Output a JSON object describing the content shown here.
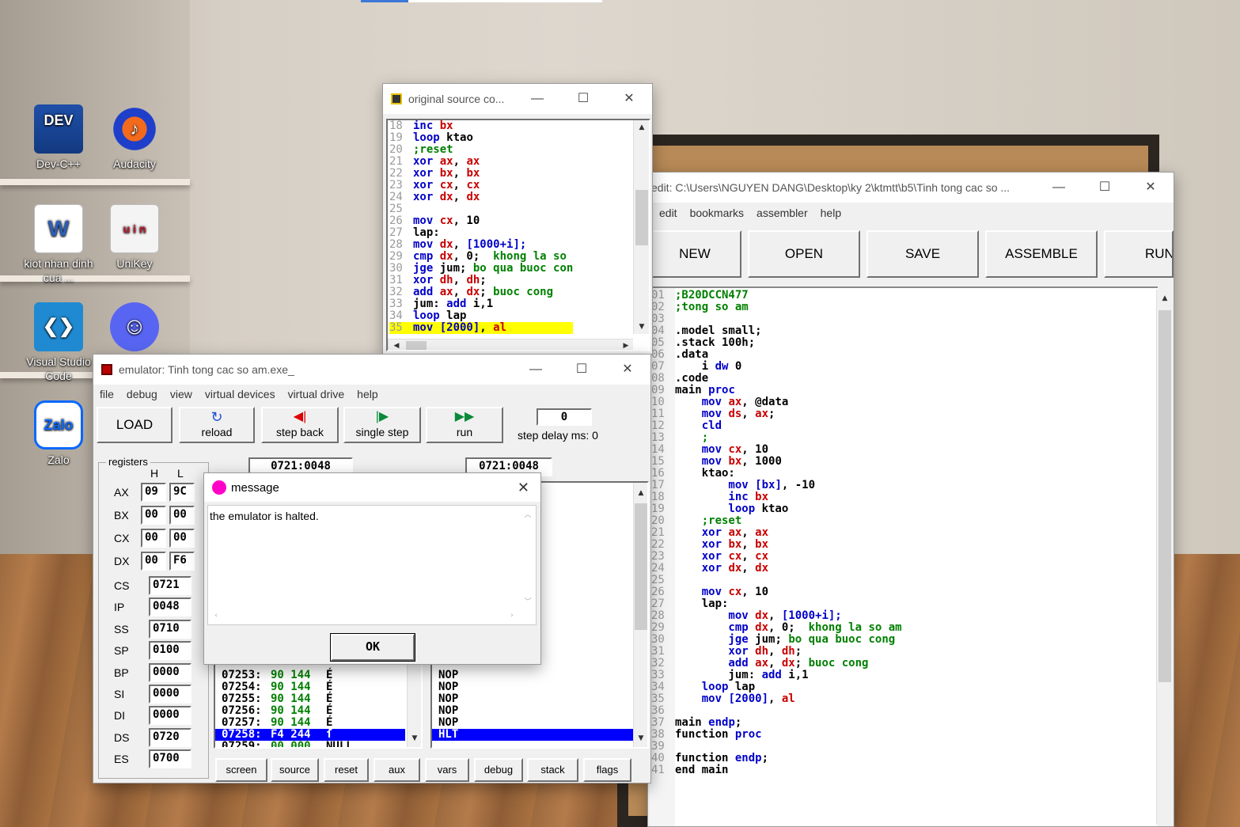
{
  "desktop": {
    "icons": [
      {
        "label": "Dev-C++",
        "name": "devcpp-icon",
        "glyph": "DEV"
      },
      {
        "label": "Audacity",
        "name": "audacity-icon",
        "glyph": "♪"
      },
      {
        "label": "kiot nhan dinh cua ...",
        "name": "word-doc-icon",
        "glyph": "W"
      },
      {
        "label": "UniKey",
        "name": "unikey-icon",
        "glyph": "u i n"
      },
      {
        "label": "Visual Studio Code",
        "name": "vscode-icon",
        "glyph": "❮❯"
      },
      {
        "label": "",
        "name": "discord-icon",
        "glyph": "☺"
      },
      {
        "label": "Zalo",
        "name": "zalo-icon",
        "glyph": "Zalo"
      }
    ]
  },
  "source_window": {
    "title": "original source co...",
    "lines": [
      {
        "n": "18",
        "code": [
          [
            "inc ",
            "k"
          ],
          [
            "bx",
            "r"
          ]
        ]
      },
      {
        "n": "19",
        "code": [
          [
            "loop ",
            "k"
          ],
          [
            "ktao",
            "bk"
          ]
        ]
      },
      {
        "n": "20",
        "code": [
          [
            ";reset",
            "g"
          ]
        ]
      },
      {
        "n": "21",
        "code": [
          [
            "xor ",
            "k"
          ],
          [
            "ax",
            "r"
          ],
          [
            ", ",
            "bk"
          ],
          [
            "ax",
            "r"
          ]
        ]
      },
      {
        "n": "22",
        "code": [
          [
            "xor ",
            "k"
          ],
          [
            "bx",
            "r"
          ],
          [
            ", ",
            "bk"
          ],
          [
            "bx",
            "r"
          ]
        ]
      },
      {
        "n": "23",
        "code": [
          [
            "xor ",
            "k"
          ],
          [
            "cx",
            "r"
          ],
          [
            ", ",
            "bk"
          ],
          [
            "cx",
            "r"
          ]
        ]
      },
      {
        "n": "24",
        "code": [
          [
            "xor ",
            "k"
          ],
          [
            "dx",
            "r"
          ],
          [
            ", ",
            "bk"
          ],
          [
            "dx",
            "r"
          ]
        ]
      },
      {
        "n": "25",
        "code": []
      },
      {
        "n": "26",
        "code": [
          [
            "mov ",
            "k"
          ],
          [
            "cx",
            "r"
          ],
          [
            ", 10",
            "bk"
          ]
        ]
      },
      {
        "n": "27",
        "code": [
          [
            "lap:",
            "bk"
          ]
        ]
      },
      {
        "n": "28",
        "code": [
          [
            "mov ",
            "k"
          ],
          [
            "dx",
            "r"
          ],
          [
            ", ",
            "bk"
          ],
          [
            "[1000+i];",
            "k"
          ]
        ]
      },
      {
        "n": "29",
        "code": [
          [
            "cmp ",
            "k"
          ],
          [
            "dx",
            "r"
          ],
          [
            ", 0;  ",
            "bk"
          ],
          [
            "khong la so",
            "g"
          ]
        ]
      },
      {
        "n": "30",
        "code": [
          [
            "jge ",
            "k"
          ],
          [
            "jum; ",
            "bk"
          ],
          [
            "bo qua buoc con",
            "g"
          ]
        ]
      },
      {
        "n": "31",
        "code": [
          [
            "xor ",
            "k"
          ],
          [
            "dh",
            "r"
          ],
          [
            ", ",
            "bk"
          ],
          [
            "dh",
            "r"
          ],
          [
            ";",
            "bk"
          ]
        ]
      },
      {
        "n": "32",
        "code": [
          [
            "add ",
            "k"
          ],
          [
            "ax",
            "r"
          ],
          [
            ", ",
            "bk"
          ],
          [
            "dx",
            "r"
          ],
          [
            "; ",
            "bk"
          ],
          [
            "buoc cong",
            "g"
          ]
        ]
      },
      {
        "n": "33",
        "code": [
          [
            "jum: ",
            "bk"
          ],
          [
            "add ",
            "k"
          ],
          [
            "i,1",
            "bk"
          ]
        ]
      },
      {
        "n": "34",
        "code": [
          [
            "loop ",
            "k"
          ],
          [
            "lap",
            "bk"
          ]
        ]
      },
      {
        "n": "35",
        "code": [
          [
            "mov ",
            "k"
          ],
          [
            "[2000]",
            "k"
          ],
          [
            ", ",
            "bk"
          ],
          [
            "al",
            "r"
          ]
        ],
        "highlight": true
      }
    ]
  },
  "editor_window": {
    "title": "edit: C:\\Users\\NGUYEN DANG\\Desktop\\ky 2\\ktmtt\\b5\\Tinh tong cac so ...",
    "menu": [
      "edit",
      "bookmarks",
      "assembler",
      "help"
    ],
    "buttons": [
      "NEW",
      "OPEN",
      "SAVE",
      "ASSEMBLE",
      "RUN"
    ],
    "lines": [
      {
        "n": "01",
        "code": [
          [
            ";B20DCCN477",
            "g"
          ]
        ]
      },
      {
        "n": "02",
        "code": [
          [
            ";tong so am",
            "g"
          ]
        ]
      },
      {
        "n": "03",
        "code": []
      },
      {
        "n": "04",
        "code": [
          [
            ".model small;",
            "bk"
          ]
        ]
      },
      {
        "n": "05",
        "code": [
          [
            ".stack 100h;",
            "bk"
          ]
        ]
      },
      {
        "n": "06",
        "code": [
          [
            ".data",
            "bk"
          ]
        ]
      },
      {
        "n": "07",
        "code": [
          [
            "    i ",
            "bk"
          ],
          [
            "dw ",
            "k"
          ],
          [
            "0",
            "bk"
          ]
        ]
      },
      {
        "n": "08",
        "code": [
          [
            ".code",
            "bk"
          ]
        ]
      },
      {
        "n": "09",
        "code": [
          [
            "main ",
            "bk"
          ],
          [
            "proc",
            "k"
          ]
        ]
      },
      {
        "n": "10",
        "code": [
          [
            "    mov ",
            "k"
          ],
          [
            "ax",
            "r"
          ],
          [
            ", @data",
            "bk"
          ]
        ]
      },
      {
        "n": "11",
        "code": [
          [
            "    mov ",
            "k"
          ],
          [
            "ds",
            "r"
          ],
          [
            ", ",
            "bk"
          ],
          [
            "ax",
            "r"
          ],
          [
            ";",
            "bk"
          ]
        ]
      },
      {
        "n": "12",
        "code": [
          [
            "    cld",
            "k"
          ]
        ]
      },
      {
        "n": "13",
        "code": [
          [
            "    ;",
            "g"
          ]
        ]
      },
      {
        "n": "14",
        "code": [
          [
            "    mov ",
            "k"
          ],
          [
            "cx",
            "r"
          ],
          [
            ", 10",
            "bk"
          ]
        ]
      },
      {
        "n": "15",
        "code": [
          [
            "    mov ",
            "k"
          ],
          [
            "bx",
            "r"
          ],
          [
            ", 1000",
            "bk"
          ]
        ]
      },
      {
        "n": "16",
        "code": [
          [
            "    ktao:",
            "bk"
          ]
        ]
      },
      {
        "n": "17",
        "code": [
          [
            "        mov ",
            "k"
          ],
          [
            "[bx]",
            "k"
          ],
          [
            ", -10",
            "bk"
          ]
        ]
      },
      {
        "n": "18",
        "code": [
          [
            "        inc ",
            "k"
          ],
          [
            "bx",
            "r"
          ]
        ]
      },
      {
        "n": "19",
        "code": [
          [
            "        loop ",
            "k"
          ],
          [
            "ktao",
            "bk"
          ]
        ]
      },
      {
        "n": "20",
        "code": [
          [
            "    ;reset",
            "g"
          ]
        ]
      },
      {
        "n": "21",
        "code": [
          [
            "    xor ",
            "k"
          ],
          [
            "ax",
            "r"
          ],
          [
            ", ",
            "bk"
          ],
          [
            "ax",
            "r"
          ]
        ]
      },
      {
        "n": "22",
        "code": [
          [
            "    xor ",
            "k"
          ],
          [
            "bx",
            "r"
          ],
          [
            ", ",
            "bk"
          ],
          [
            "bx",
            "r"
          ]
        ]
      },
      {
        "n": "23",
        "code": [
          [
            "    xor ",
            "k"
          ],
          [
            "cx",
            "r"
          ],
          [
            ", ",
            "bk"
          ],
          [
            "cx",
            "r"
          ]
        ]
      },
      {
        "n": "24",
        "code": [
          [
            "    xor ",
            "k"
          ],
          [
            "dx",
            "r"
          ],
          [
            ", ",
            "bk"
          ],
          [
            "dx",
            "r"
          ]
        ]
      },
      {
        "n": "25",
        "code": []
      },
      {
        "n": "26",
        "code": [
          [
            "    mov ",
            "k"
          ],
          [
            "cx",
            "r"
          ],
          [
            ", 10",
            "bk"
          ]
        ]
      },
      {
        "n": "27",
        "code": [
          [
            "    lap:",
            "bk"
          ]
        ]
      },
      {
        "n": "28",
        "code": [
          [
            "        mov ",
            "k"
          ],
          [
            "dx",
            "r"
          ],
          [
            ", ",
            "bk"
          ],
          [
            "[1000+i];",
            "k"
          ]
        ]
      },
      {
        "n": "29",
        "code": [
          [
            "        cmp ",
            "k"
          ],
          [
            "dx",
            "r"
          ],
          [
            ", 0;  ",
            "bk"
          ],
          [
            "khong la so am",
            "g"
          ]
        ]
      },
      {
        "n": "30",
        "code": [
          [
            "        jge ",
            "k"
          ],
          [
            "jum; ",
            "bk"
          ],
          [
            "bo qua buoc cong",
            "g"
          ]
        ]
      },
      {
        "n": "31",
        "code": [
          [
            "        xor ",
            "k"
          ],
          [
            "dh",
            "r"
          ],
          [
            ", ",
            "bk"
          ],
          [
            "dh",
            "r"
          ],
          [
            ";",
            "bk"
          ]
        ]
      },
      {
        "n": "32",
        "code": [
          [
            "        add ",
            "k"
          ],
          [
            "ax",
            "r"
          ],
          [
            ", ",
            "bk"
          ],
          [
            "dx",
            "r"
          ],
          [
            "; ",
            "bk"
          ],
          [
            "buoc cong",
            "g"
          ]
        ]
      },
      {
        "n": "33",
        "code": [
          [
            "        jum: ",
            "bk"
          ],
          [
            "add ",
            "k"
          ],
          [
            "i,1",
            "bk"
          ]
        ]
      },
      {
        "n": "34",
        "code": [
          [
            "    loop ",
            "k"
          ],
          [
            "lap",
            "bk"
          ]
        ]
      },
      {
        "n": "35",
        "code": [
          [
            "    mov ",
            "k"
          ],
          [
            "[2000]",
            "k"
          ],
          [
            ", ",
            "bk"
          ],
          [
            "al",
            "r"
          ]
        ]
      },
      {
        "n": "36",
        "code": []
      },
      {
        "n": "37",
        "code": [
          [
            "main ",
            "bk"
          ],
          [
            "endp",
            "k"
          ],
          [
            ";",
            "bk"
          ]
        ]
      },
      {
        "n": "38",
        "code": [
          [
            "function ",
            "bk"
          ],
          [
            "proc",
            "k"
          ]
        ]
      },
      {
        "n": "39",
        "code": []
      },
      {
        "n": "40",
        "code": [
          [
            "function ",
            "bk"
          ],
          [
            "endp",
            "k"
          ],
          [
            ";",
            "bk"
          ]
        ]
      },
      {
        "n": "41",
        "code": [
          [
            "end main",
            "bk"
          ]
        ]
      }
    ]
  },
  "emulator_window": {
    "title": "emulator: Tinh tong cac so am.exe_",
    "menu": [
      "file",
      "debug",
      "view",
      "virtual devices",
      "virtual drive",
      "help"
    ],
    "toolbar": {
      "load": "LOAD",
      "reload": "reload",
      "step_back": "step back",
      "single_step": "single step",
      "run": "run",
      "step_delay_label": "step delay ms: 0",
      "step_delay_value": "0"
    },
    "registers_label": "registers",
    "h_label": "H",
    "l_label": "L",
    "regs8": [
      {
        "name": "AX",
        "h": "09",
        "l": "9C"
      },
      {
        "name": "BX",
        "h": "00",
        "l": "00"
      },
      {
        "name": "CX",
        "h": "00",
        "l": "00"
      },
      {
        "name": "DX",
        "h": "00",
        "l": "F6"
      }
    ],
    "regs16": [
      {
        "name": "CS",
        "v": "0721"
      },
      {
        "name": "IP",
        "v": "0048"
      },
      {
        "name": "SS",
        "v": "0710"
      },
      {
        "name": "SP",
        "v": "0100"
      },
      {
        "name": "BP",
        "v": "0000"
      },
      {
        "name": "SI",
        "v": "0000"
      },
      {
        "name": "DI",
        "v": "0000"
      },
      {
        "name": "DS",
        "v": "0720"
      },
      {
        "name": "ES",
        "v": "0700"
      }
    ],
    "addr_left": "0721:0048",
    "addr_right": "0721:0048",
    "memory": [
      {
        "a": "07253:",
        "b": "90 144",
        "c": "É"
      },
      {
        "a": "07254:",
        "b": "90 144",
        "c": "É"
      },
      {
        "a": "07255:",
        "b": "90 144",
        "c": "É"
      },
      {
        "a": "07256:",
        "b": "90 144",
        "c": "É"
      },
      {
        "a": "07257:",
        "b": "90 144",
        "c": "É"
      },
      {
        "a": "07258:",
        "b": "F4 244",
        "c": "ſ",
        "sel": true
      },
      {
        "a": "07259:",
        "b": "00 000",
        "c": "NULL"
      }
    ],
    "disasm": [
      {
        "t": "NOP"
      },
      {
        "t": "NOP"
      },
      {
        "t": "NOP"
      },
      {
        "t": "NOP"
      },
      {
        "t": "NOP"
      },
      {
        "t": "HLT",
        "sel": true
      },
      {
        "t": "..."
      }
    ],
    "tabs": [
      "screen",
      "source",
      "reset",
      "aux",
      "vars",
      "debug",
      "stack",
      "flags"
    ]
  },
  "message_dialog": {
    "title": "message",
    "text": "the emulator is halted.",
    "ok": "OK"
  },
  "colors": {
    "keyword": "#0000c8",
    "register": "#c80000",
    "comment": "#008000",
    "highlight": "#ffff00",
    "selection": "#0000ff"
  }
}
